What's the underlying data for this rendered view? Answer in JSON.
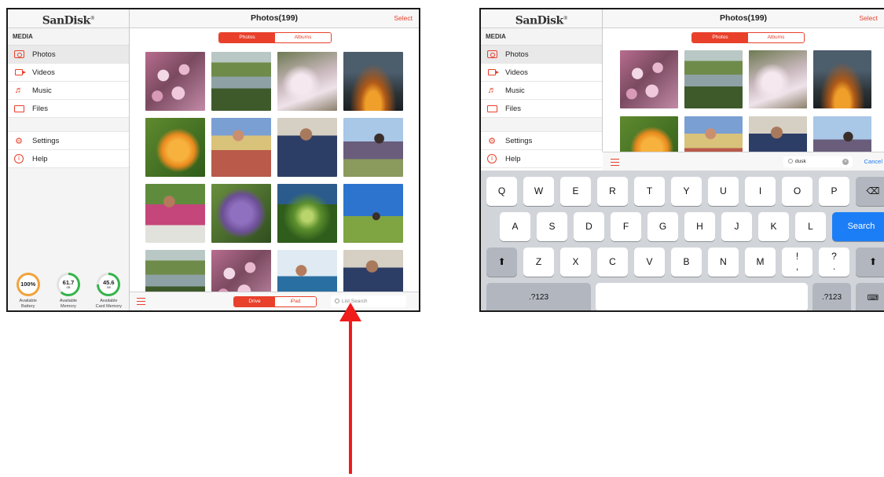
{
  "brand": "SanDisk",
  "sidebar": {
    "section_label": "MEDIA",
    "items": [
      {
        "label": "Photos",
        "icon": "camera-icon"
      },
      {
        "label": "Videos",
        "icon": "video-icon"
      },
      {
        "label": "Music",
        "icon": "music-icon"
      },
      {
        "label": "Files",
        "icon": "folder-icon"
      }
    ],
    "secondary": [
      {
        "label": "Settings",
        "icon": "gear-icon"
      },
      {
        "label": "Help",
        "icon": "info-icon"
      }
    ],
    "gauges": [
      {
        "value": "100%",
        "unit": "",
        "caption_1": "Available",
        "caption_2": "Battery",
        "fraction": 1.0,
        "color": "#f2a23a"
      },
      {
        "value": "61.7",
        "unit": "GB",
        "caption_1": "Available",
        "caption_2": "Memory",
        "fraction": 0.62,
        "color": "#36b34a"
      },
      {
        "value": "45.6",
        "unit": "GB",
        "caption_1": "Available",
        "caption_2": "Card Memory",
        "fraction": 0.75,
        "color": "#36b34a"
      }
    ]
  },
  "header": {
    "title": "Photos(199)",
    "select_label": "Select"
  },
  "top_tabs": {
    "photos": "Photos",
    "albums": "Albums"
  },
  "bottom_tabs": {
    "drive": "Drive",
    "ipad": "iPad"
  },
  "search": {
    "placeholder": "List Search",
    "query": "dusk",
    "cancel_label": "Cancel"
  },
  "keyboard": {
    "row1": [
      "Q",
      "W",
      "E",
      "R",
      "T",
      "Y",
      "U",
      "I",
      "O",
      "P"
    ],
    "row2": [
      "A",
      "S",
      "D",
      "F",
      "G",
      "H",
      "J",
      "K",
      "L"
    ],
    "row3": [
      "Z",
      "X",
      "C",
      "V",
      "B",
      "N",
      "M"
    ],
    "punct1_top": "!",
    "punct1_bottom": ",",
    "punct2_top": "?",
    "punct2_bottom": ".",
    "search_key": "Search",
    "numbers_key": ".?123"
  },
  "colors": {
    "accent": "#e8402b",
    "arrow": "#f01b1b",
    "ios_blue": "#1c7ef7"
  }
}
